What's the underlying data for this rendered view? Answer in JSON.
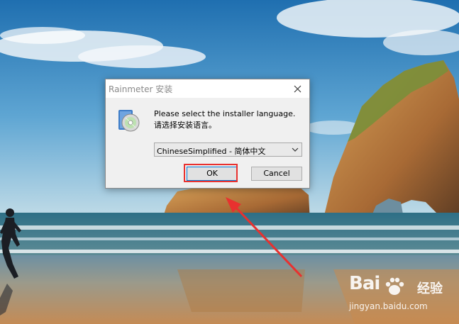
{
  "dialog": {
    "title": "Rainmeter 安装",
    "message_en": "Please select the installer language.",
    "message_zh": "请选择安装语言。",
    "language_select": {
      "selected": "ChineseSimplified - 简体中文"
    },
    "ok_label": "OK",
    "cancel_label": "Cancel"
  },
  "watermark": {
    "logo_text_left": "Bai",
    "logo_text_right": "经验",
    "url": "jingyan.baidu.com"
  },
  "colors": {
    "highlight": "#e8312f",
    "ok_focus_border": "#0078d7"
  }
}
